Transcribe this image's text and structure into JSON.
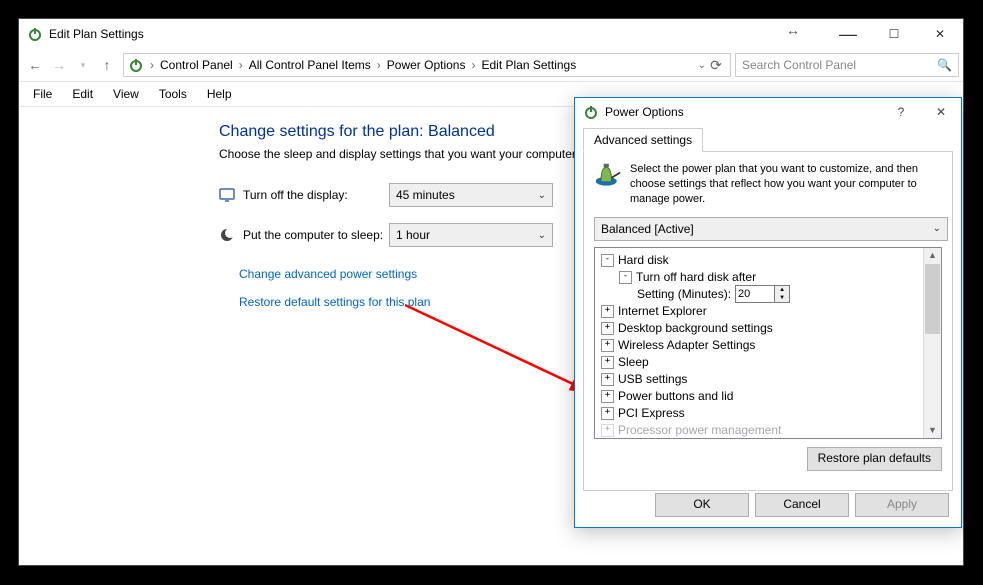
{
  "main": {
    "title": "Edit Plan Settings",
    "breadcrumb": [
      "Control Panel",
      "All Control Panel Items",
      "Power Options",
      "Edit Plan Settings"
    ],
    "search_placeholder": "Search Control Panel",
    "menu": [
      "File",
      "Edit",
      "View",
      "Tools",
      "Help"
    ],
    "heading": "Change settings for the plan: Balanced",
    "subheading": "Choose the sleep and display settings that you want your computer to use.",
    "rows": {
      "display_label": "Turn off the display:",
      "display_value": "45 minutes",
      "sleep_label": "Put the computer to sleep:",
      "sleep_value": "1 hour"
    },
    "links": {
      "advanced": "Change advanced power settings",
      "restore": "Restore default settings for this plan"
    }
  },
  "popup": {
    "title": "Power Options",
    "tab": "Advanced settings",
    "lead": "Select the power plan that you want to customize, and then choose settings that reflect how you want your computer to manage power.",
    "plan_value": "Balanced [Active]",
    "tree": {
      "hard_disk": "Hard disk",
      "turn_off_hd": "Turn off hard disk after",
      "setting_label": "Setting (Minutes):",
      "setting_value": "20",
      "ie": "Internet Explorer",
      "desktop_bg": "Desktop background settings",
      "wireless": "Wireless Adapter Settings",
      "sleep": "Sleep",
      "usb": "USB settings",
      "power_buttons": "Power buttons and lid",
      "pci": "PCI Express",
      "processor": "Processor power management"
    },
    "restore_btn": "Restore plan defaults",
    "ok": "OK",
    "cancel": "Cancel",
    "apply": "Apply"
  }
}
